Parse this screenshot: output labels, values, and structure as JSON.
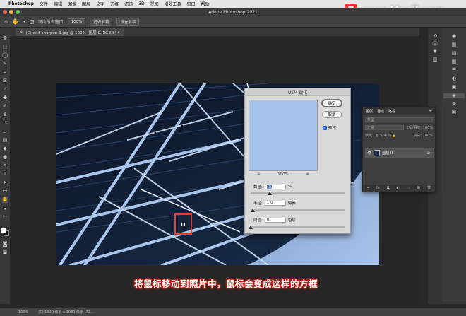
{
  "menubar": {
    "app": "Photoshop",
    "items": [
      "文件",
      "编辑",
      "图像",
      "图层",
      "文字",
      "选择",
      "滤镜",
      "3D",
      "视图",
      "增效工具",
      "窗口",
      "帮助"
    ]
  },
  "watermark": {
    "logo_letter": "Z",
    "text": "www.MacZ.com"
  },
  "window": {
    "title": "Adobe Photoshop 2021"
  },
  "options_bar": {
    "scroll_all_label": "滚动所有窗口",
    "zoom_value": "100%",
    "fit_screen": "适合屏幕",
    "fill_screen": "填充屏幕"
  },
  "document_tab": {
    "title": "(C) edit-sharpen-1.jpg @ 100% (图层 0, RGB/8) *"
  },
  "usm_dialog": {
    "title": "USM 锐化",
    "ok": "确定",
    "cancel": "取消",
    "preview_label": "预览",
    "zoom": "100%",
    "amount_label": "数量:",
    "amount_value": "50",
    "amount_unit": "%",
    "amount_fraction": 0.2,
    "radius_label": "半径:",
    "radius_value": "1.0",
    "radius_unit": "像素",
    "radius_fraction": 0.02,
    "threshold_label": "阈值:",
    "threshold_value": "0",
    "threshold_unit": "色阶",
    "threshold_fraction": 0.0
  },
  "layers_panel": {
    "tabs": [
      "图层",
      "通道",
      "路径"
    ],
    "kind_label": "类型",
    "mode": "正常",
    "opacity": "不透明度: 100%",
    "lock_label": "锁定:",
    "fill": "填充: 100%",
    "layer_name": "图层 0"
  },
  "caption": "将鼠标移动到照片中，鼠标会变成这样的方框",
  "status": {
    "zoom": "100%",
    "info": "(C) 1920 像素 x 1080 像素 (72..."
  },
  "colors": {
    "accent_red": "#e04030",
    "preview_sky": "#a8c2ee"
  }
}
